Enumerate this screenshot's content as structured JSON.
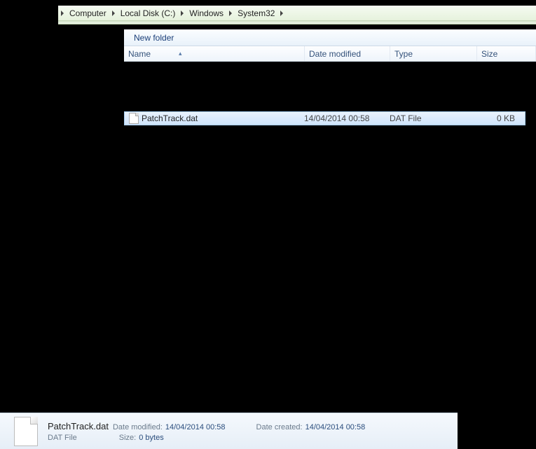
{
  "breadcrumb": {
    "items": [
      "Computer",
      "Local Disk (C:)",
      "Windows",
      "System32"
    ]
  },
  "toolbar": {
    "new_folder": "New folder"
  },
  "columns": {
    "name": "Name",
    "date": "Date modified",
    "type": "Type",
    "size": "Size"
  },
  "file": {
    "name": "PatchTrack.dat",
    "date_modified": "14/04/2014 00:58",
    "type": "DAT File",
    "size": "0 KB"
  },
  "details": {
    "name": "PatchTrack.dat",
    "type": "DAT File",
    "labels": {
      "date_modified": "Date modified:",
      "date_created": "Date created:",
      "size": "Size:"
    },
    "date_modified": "14/04/2014 00:58",
    "date_created": "14/04/2014 00:58",
    "size": "0 bytes"
  }
}
